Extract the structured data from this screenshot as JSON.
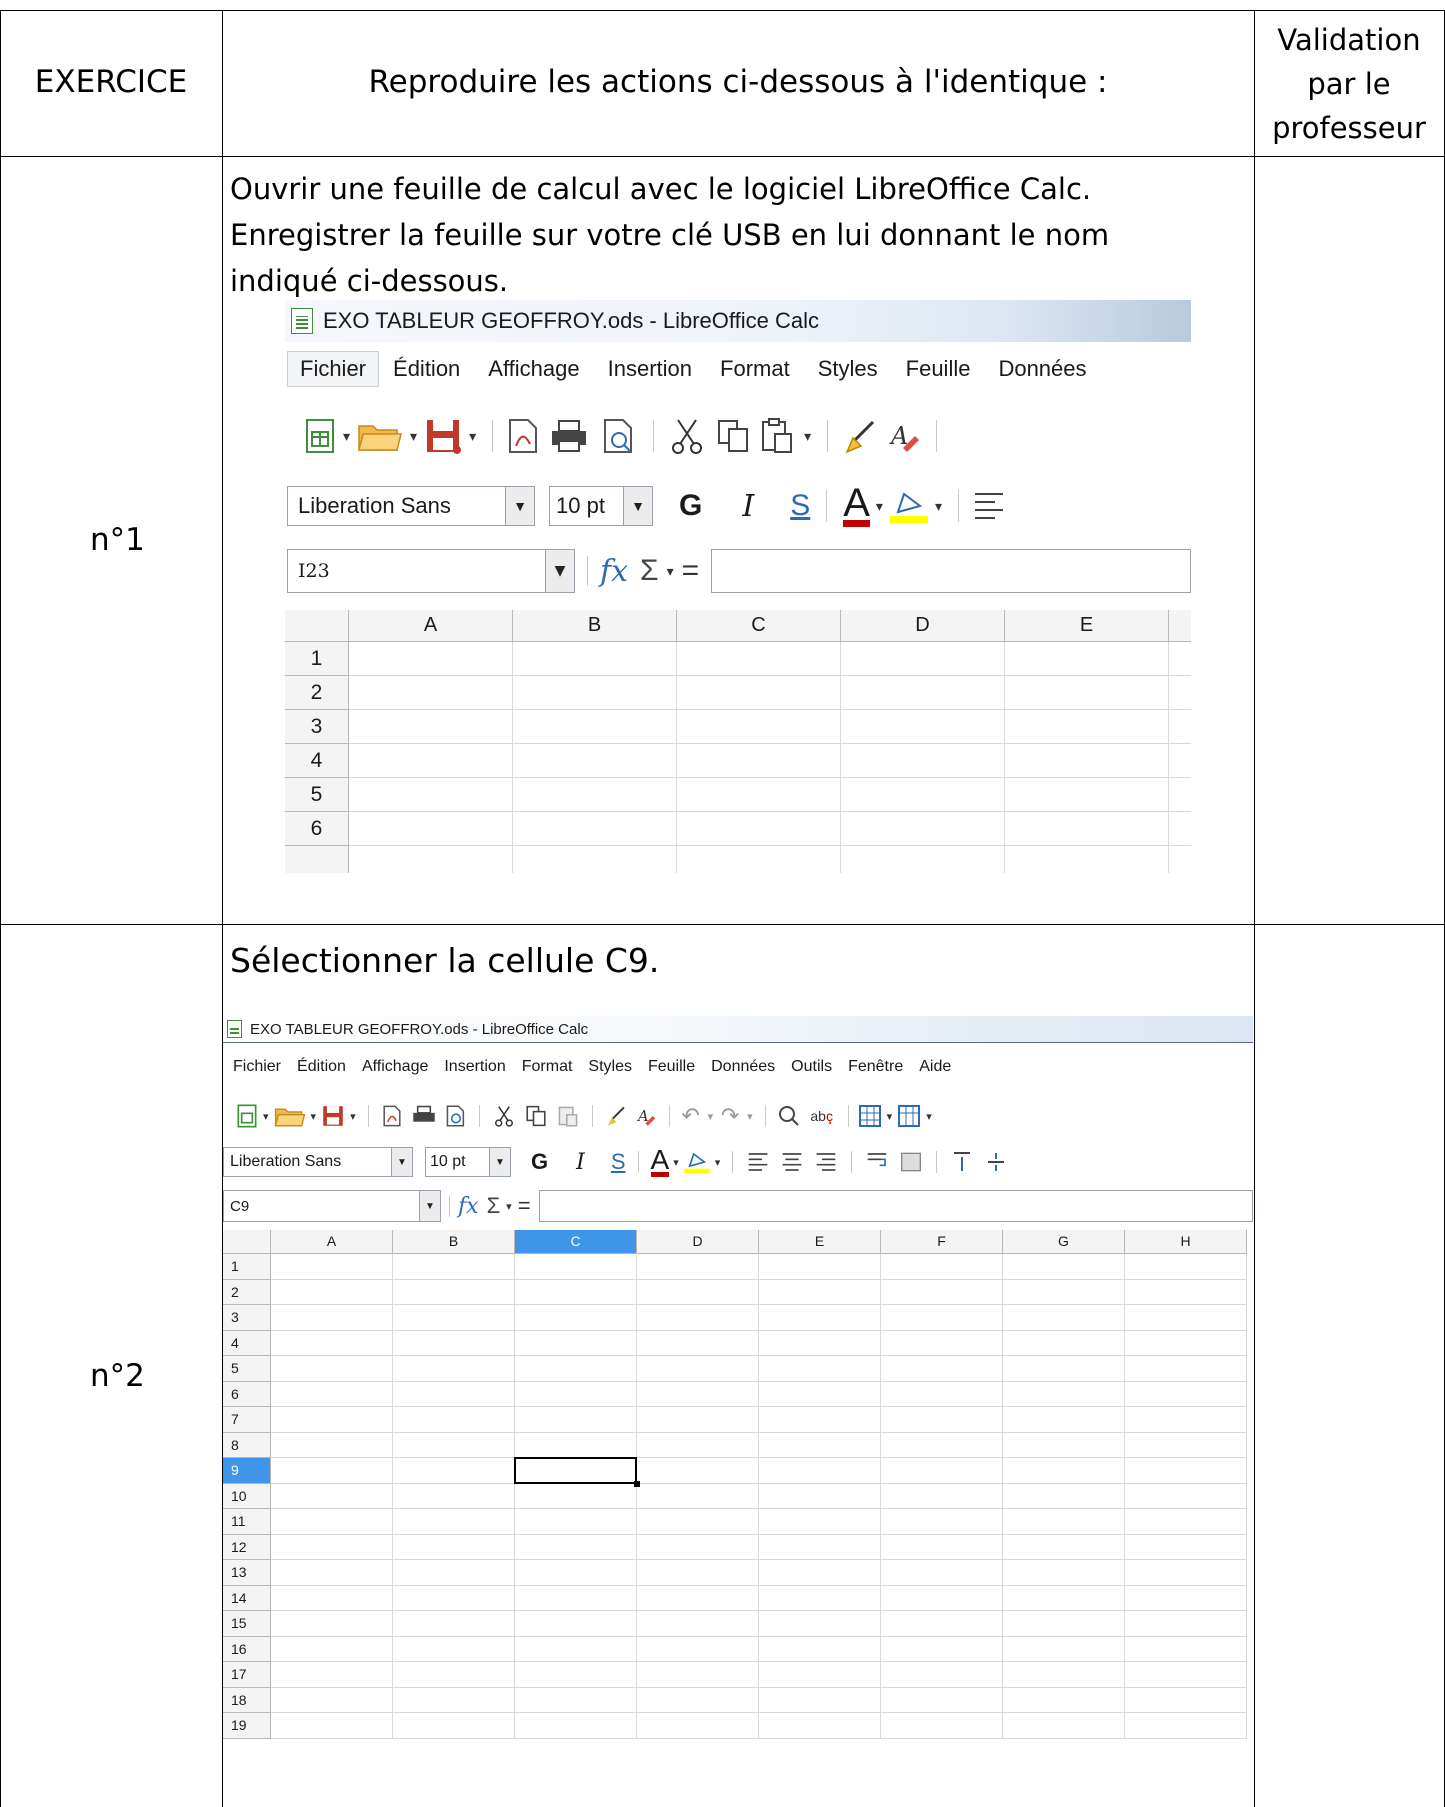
{
  "header": {
    "col_exercise": "EXERCICE",
    "col_instructions": "Reproduire les actions ci-dessous à l'identique :",
    "col_validation": [
      "Validation",
      "par le",
      "professeur"
    ]
  },
  "exercises": [
    {
      "number": "n°1",
      "instruction_lines": [
        "Ouvrir une feuille de calcul avec le logiciel LibreOffice Calc.",
        "Enregistrer la feuille sur votre clé USB en lui donnant le nom",
        "indiqué ci-dessous."
      ],
      "screenshot": {
        "window_title": "EXO TABLEUR GEOFFROY.ods - LibreOffice Calc",
        "menu": [
          "Fichier",
          "Édition",
          "Affichage",
          "Insertion",
          "Format",
          "Styles",
          "Feuille",
          "Données"
        ],
        "font_name": "Liberation Sans",
        "font_size": "10 pt",
        "format_buttons": [
          "G",
          "I",
          "S",
          "A"
        ],
        "fx_symbol": "fx",
        "sum_symbol": "Σ",
        "equals_symbol": "=",
        "name_box": "I23",
        "columns": [
          "A",
          "B",
          "C",
          "D",
          "E"
        ],
        "rows": [
          "1",
          "2",
          "3",
          "4",
          "5",
          "6"
        ]
      }
    },
    {
      "number": "n°2",
      "instruction_lines": [
        "Sélectionner la cellule C9."
      ],
      "screenshot": {
        "window_title": "EXO TABLEUR GEOFFROY.ods - LibreOffice Calc",
        "menu": [
          "Fichier",
          "Édition",
          "Affichage",
          "Insertion",
          "Format",
          "Styles",
          "Feuille",
          "Données",
          "Outils",
          "Fenêtre",
          "Aide"
        ],
        "font_name": "Liberation Sans",
        "font_size": "10 pt",
        "format_buttons": [
          "G",
          "I",
          "S",
          "A"
        ],
        "fx_symbol": "fx",
        "sum_symbol": "Σ",
        "equals_symbol": "=",
        "name_box": "C9",
        "columns": [
          "A",
          "B",
          "C",
          "D",
          "E",
          "F",
          "G",
          "H"
        ],
        "rows": [
          "1",
          "2",
          "3",
          "4",
          "5",
          "6",
          "7",
          "8",
          "9",
          "10",
          "11",
          "12",
          "13",
          "14",
          "15",
          "16",
          "17",
          "18",
          "19"
        ],
        "selected_column": "C",
        "selected_row": "9"
      }
    }
  ],
  "icons": [
    "spreadsheet-doc-icon",
    "new-icon",
    "open-folder-icon",
    "save-icon",
    "export-pdf-icon",
    "print-icon",
    "print-preview-icon",
    "cut-icon",
    "copy-icon",
    "paste-icon",
    "clone-format-icon",
    "clear-format-icon",
    "undo-icon",
    "redo-icon",
    "find-replace-icon",
    "spellcheck-icon",
    "table-icon",
    "font-color-icon",
    "highlight-icon",
    "align-icon"
  ],
  "colors": {
    "selection_blue": "#3f95e8",
    "font_color_red": "#c00000",
    "highlight_yellow": "#ffff00"
  }
}
